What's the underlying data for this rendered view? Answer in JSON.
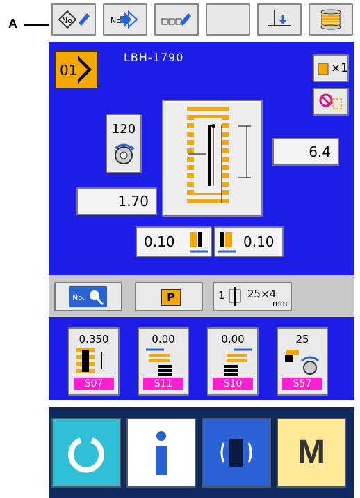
{
  "callout": {
    "letter": "A"
  },
  "toolbar": {
    "items": [
      {
        "icon": "pattern-number-edit-icon"
      },
      {
        "icon": "pattern-number-next-icon"
      },
      {
        "icon": "text-edit-icon"
      },
      {
        "icon": "blank-button-icon"
      },
      {
        "icon": "needle-down-icon"
      },
      {
        "icon": "bobbin-thread-icon"
      }
    ]
  },
  "header": {
    "model": "LBH-1790",
    "pattern_no": "01"
  },
  "counters": {
    "multiplier": "×1"
  },
  "params": {
    "speed": "120",
    "length": "6.4",
    "width": "1.70",
    "left_gap": "0.10",
    "right_gap": "0.10"
  },
  "tools": {
    "p_label": "P",
    "needle_size": "25×4",
    "needle_unit": "mm",
    "needle_prefix": "1"
  },
  "settings": [
    {
      "value": "0.350",
      "code": "S07"
    },
    {
      "value": "0.00",
      "code": "S11"
    },
    {
      "value": "0.00",
      "code": "S10"
    },
    {
      "value": "25",
      "code": "S57"
    }
  ],
  "bottom": {
    "m_label": "M"
  },
  "colors": {
    "blue": "#1d1de8",
    "orange": "#f5a800",
    "magenta": "#ff1fd0",
    "navy": "#0f2a5f"
  }
}
